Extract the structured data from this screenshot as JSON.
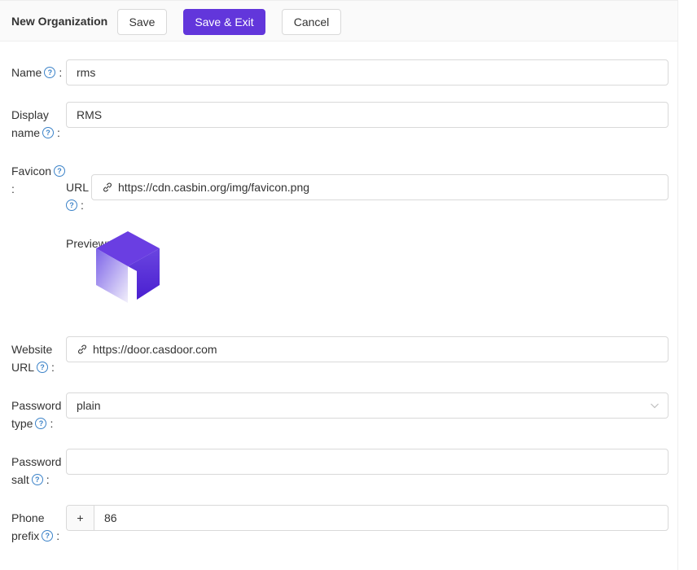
{
  "header": {
    "title": "New Organization",
    "save_label": "Save",
    "save_exit_label": "Save & Exit",
    "cancel_label": "Cancel"
  },
  "form": {
    "name": {
      "label": "Name",
      "value": "rms"
    },
    "display_name": {
      "label_line1": "Display",
      "label_line2": "name",
      "value": "RMS"
    },
    "favicon": {
      "label": "Favicon",
      "url_label": "URL",
      "url_value": "https://cdn.casbin.org/img/favicon.png",
      "preview_label": "Preview:"
    },
    "website_url": {
      "label_line1": "Website",
      "label_line2": "URL",
      "value": "https://door.casdoor.com"
    },
    "password_type": {
      "label_line1": "Password",
      "label_line2": "type",
      "value": "plain"
    },
    "password_salt": {
      "label_line1": "Password",
      "label_line2": "salt",
      "value": ""
    },
    "phone_prefix": {
      "label_line1": "Phone",
      "label_line2": "prefix",
      "addon": "+",
      "value": "86"
    }
  },
  "icons": {
    "help": "question-circle-icon",
    "link": "link-icon",
    "chevron": "chevron-down-icon"
  },
  "colors": {
    "primary": "#6236db",
    "help_icon": "#3b82c8",
    "border": "#d9d9d9"
  }
}
